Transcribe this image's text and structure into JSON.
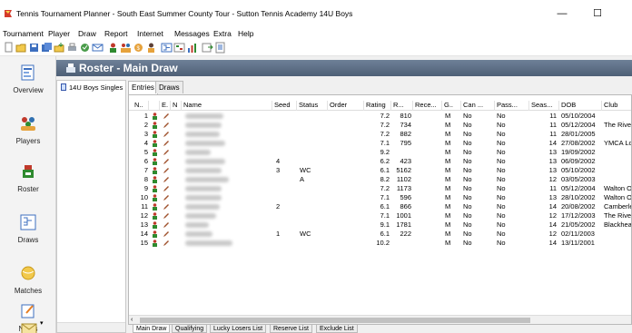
{
  "window": {
    "title": "Tennis Tournament Planner - South East Summer County Tour - Sutton Tennis Academy 14U Boys",
    "minimize": "—",
    "maximize": "☐"
  },
  "menu": [
    "Tournament",
    "Player",
    "Draw",
    "Report",
    "Internet",
    "Messages",
    "Extra",
    "Help"
  ],
  "toolbar": {
    "icons": [
      "new-icon",
      "open-icon",
      "save-icon",
      "save-all-icon",
      "import-icon",
      "print-icon",
      "mail-icon",
      "email-icon",
      "player-icon",
      "players-icon",
      "payment-icon",
      "official-icon",
      "draw-icon",
      "schedule-icon",
      "chart-icon",
      "export-icon",
      "report-icon"
    ]
  },
  "nav": {
    "items": [
      {
        "label": "Overview",
        "icon": "overview-icon"
      },
      {
        "label": "Players",
        "icon": "players-icon"
      },
      {
        "label": "Roster",
        "icon": "roster-icon"
      },
      {
        "label": "Draws",
        "icon": "draws-icon"
      },
      {
        "label": "Matches",
        "icon": "matches-icon"
      },
      {
        "label": "Notes",
        "icon": "notes-icon"
      },
      {
        "label": "",
        "icon": "mail-icon"
      }
    ],
    "dropdown": "▾"
  },
  "header": {
    "title": "Roster - Main Draw"
  },
  "events": {
    "items": [
      "14U Boys Singles"
    ]
  },
  "tabs_top": [
    "Entries",
    "Draws"
  ],
  "tabs_bottom": [
    "Main Draw",
    "Qualifying",
    "Lucky Losers List",
    "Reserve List",
    "Exclude List"
  ],
  "grid": {
    "columns": [
      "N..",
      "",
      "E.",
      "N",
      "Name",
      "Seed",
      "Status",
      "Order",
      "Rating",
      "R...",
      "Rece...",
      "G..",
      "Can ...",
      "Pass...",
      "Seas...",
      "DOB",
      "Club"
    ],
    "rows": [
      {
        "n": "1",
        "seed": "",
        "status": "",
        "rating": "7.2",
        "r": "810",
        "g": "M",
        "can": "No",
        "pass": "No",
        "seas": "11",
        "dob": "05/10/2004",
        "club": ""
      },
      {
        "n": "2",
        "seed": "",
        "status": "",
        "rating": "7.2",
        "r": "734",
        "g": "M",
        "can": "No",
        "pass": "No",
        "seas": "11",
        "dob": "05/12/2004",
        "club": "The Rivers"
      },
      {
        "n": "3",
        "seed": "",
        "status": "",
        "rating": "7.2",
        "r": "882",
        "g": "M",
        "can": "No",
        "pass": "No",
        "seas": "11",
        "dob": "28/01/2005",
        "club": ""
      },
      {
        "n": "4",
        "seed": "",
        "status": "",
        "rating": "7.1",
        "r": "795",
        "g": "M",
        "can": "No",
        "pass": "No",
        "seas": "14",
        "dob": "27/08/2002",
        "club": "YMCA Lon"
      },
      {
        "n": "5",
        "seed": "",
        "status": "",
        "rating": "9.2",
        "r": "",
        "g": "M",
        "can": "No",
        "pass": "No",
        "seas": "13",
        "dob": "19/09/2002",
        "club": ""
      },
      {
        "n": "6",
        "seed": "4",
        "status": "",
        "rating": "6.2",
        "r": "423",
        "g": "M",
        "can": "No",
        "pass": "No",
        "seas": "13",
        "dob": "06/09/2002",
        "club": ""
      },
      {
        "n": "7",
        "seed": "3",
        "status": "WC",
        "rating": "6.1",
        "r": "5162",
        "g": "M",
        "can": "No",
        "pass": "No",
        "seas": "13",
        "dob": "05/10/2002",
        "club": ""
      },
      {
        "n": "8",
        "seed": "",
        "status": "A",
        "rating": "8.2",
        "r": "1102",
        "g": "M",
        "can": "No",
        "pass": "No",
        "seas": "12",
        "dob": "03/05/2003",
        "club": ""
      },
      {
        "n": "9",
        "seed": "",
        "status": "",
        "rating": "7.2",
        "r": "1173",
        "g": "M",
        "can": "No",
        "pass": "No",
        "seas": "11",
        "dob": "05/12/2004",
        "club": "Walton Or"
      },
      {
        "n": "10",
        "seed": "",
        "status": "",
        "rating": "7.1",
        "r": "596",
        "g": "M",
        "can": "No",
        "pass": "No",
        "seas": "13",
        "dob": "28/10/2002",
        "club": "Walton Or"
      },
      {
        "n": "11",
        "seed": "2",
        "status": "",
        "rating": "6.1",
        "r": "866",
        "g": "M",
        "can": "No",
        "pass": "No",
        "seas": "14",
        "dob": "20/08/2002",
        "club": "Camberley"
      },
      {
        "n": "12",
        "seed": "",
        "status": "",
        "rating": "7.1",
        "r": "1001",
        "g": "M",
        "can": "No",
        "pass": "No",
        "seas": "12",
        "dob": "17/12/2003",
        "club": "The Rivers"
      },
      {
        "n": "13",
        "seed": "",
        "status": "",
        "rating": "9.1",
        "r": "1781",
        "g": "M",
        "can": "No",
        "pass": "No",
        "seas": "14",
        "dob": "21/05/2002",
        "club": "Blackheath"
      },
      {
        "n": "14",
        "seed": "1",
        "status": "WC",
        "rating": "6.1",
        "r": "222",
        "g": "M",
        "can": "No",
        "pass": "No",
        "seas": "12",
        "dob": "02/11/2003",
        "club": ""
      },
      {
        "n": "15",
        "seed": "",
        "status": "",
        "rating": "10.2",
        "r": "",
        "g": "M",
        "can": "No",
        "pass": "No",
        "seas": "14",
        "dob": "13/11/2001",
        "club": ""
      }
    ]
  },
  "colors": {
    "header_bg": "#5b6c83",
    "person_icon": "#2f8a2f",
    "pencil_icon": "#a0522d",
    "app_icon": "#d43a2a"
  }
}
